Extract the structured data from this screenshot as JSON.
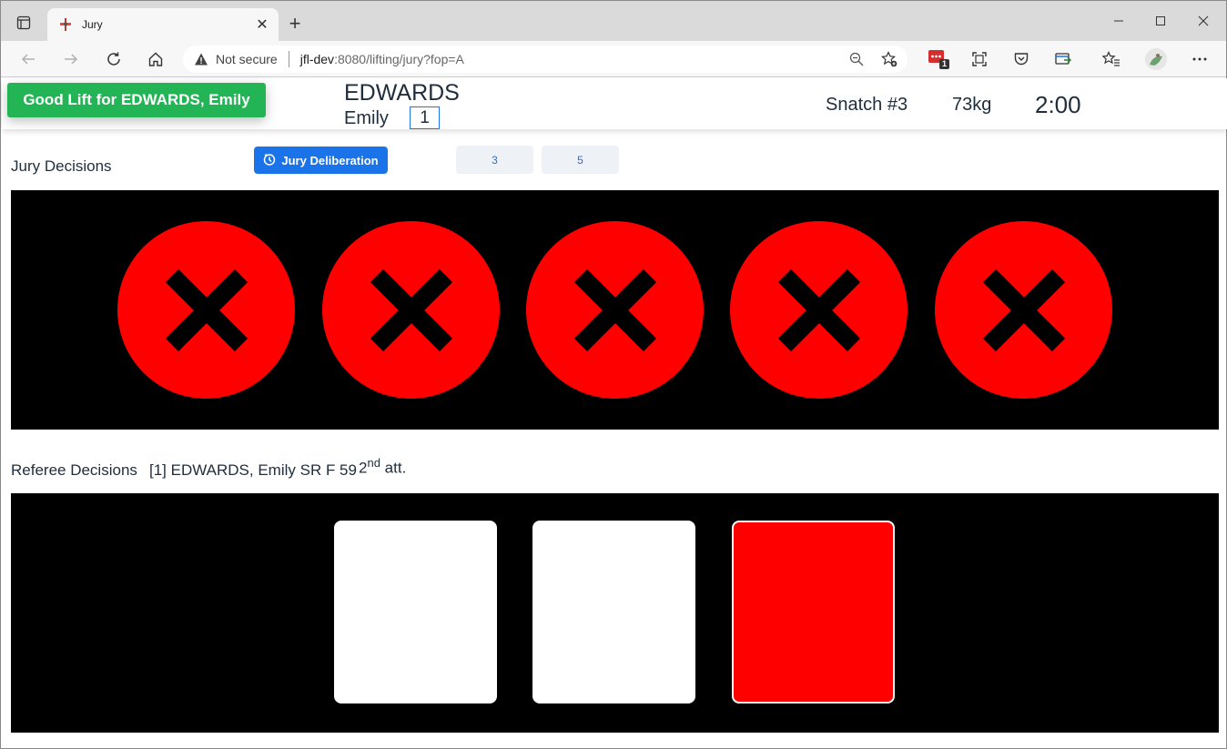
{
  "browser": {
    "tab_title": "Jury",
    "address_not_secure": "Not secure",
    "address_host": "jfl-dev",
    "address_path": ":8080/lifting/jury?fop=A",
    "extension_badge": "1"
  },
  "header": {
    "notification": "Good Lift for EDWARDS, Emily",
    "last_name": "EDWARDS",
    "first_name": "Emily",
    "start_number": "1",
    "lift_info": "Snatch #3",
    "weight": "73kg",
    "timer": "2:00"
  },
  "jury": {
    "title": "Jury Decisions",
    "deliberation_label": "Jury Deliberation",
    "size_buttons": [
      "3",
      "5"
    ],
    "decisions": [
      "bad",
      "bad",
      "bad",
      "bad",
      "bad"
    ],
    "decision_color": "#ff0000"
  },
  "referee": {
    "title": "Referee Decisions",
    "athlete_info": "[1] EDWARDS, Emily SR F 59",
    "attempt_number": "2",
    "attempt_suffix": "nd",
    "attempt_label": "att.",
    "decisions": [
      "good",
      "good",
      "bad"
    ],
    "good_color": "#ffffff",
    "bad_color": "#ff0000"
  }
}
